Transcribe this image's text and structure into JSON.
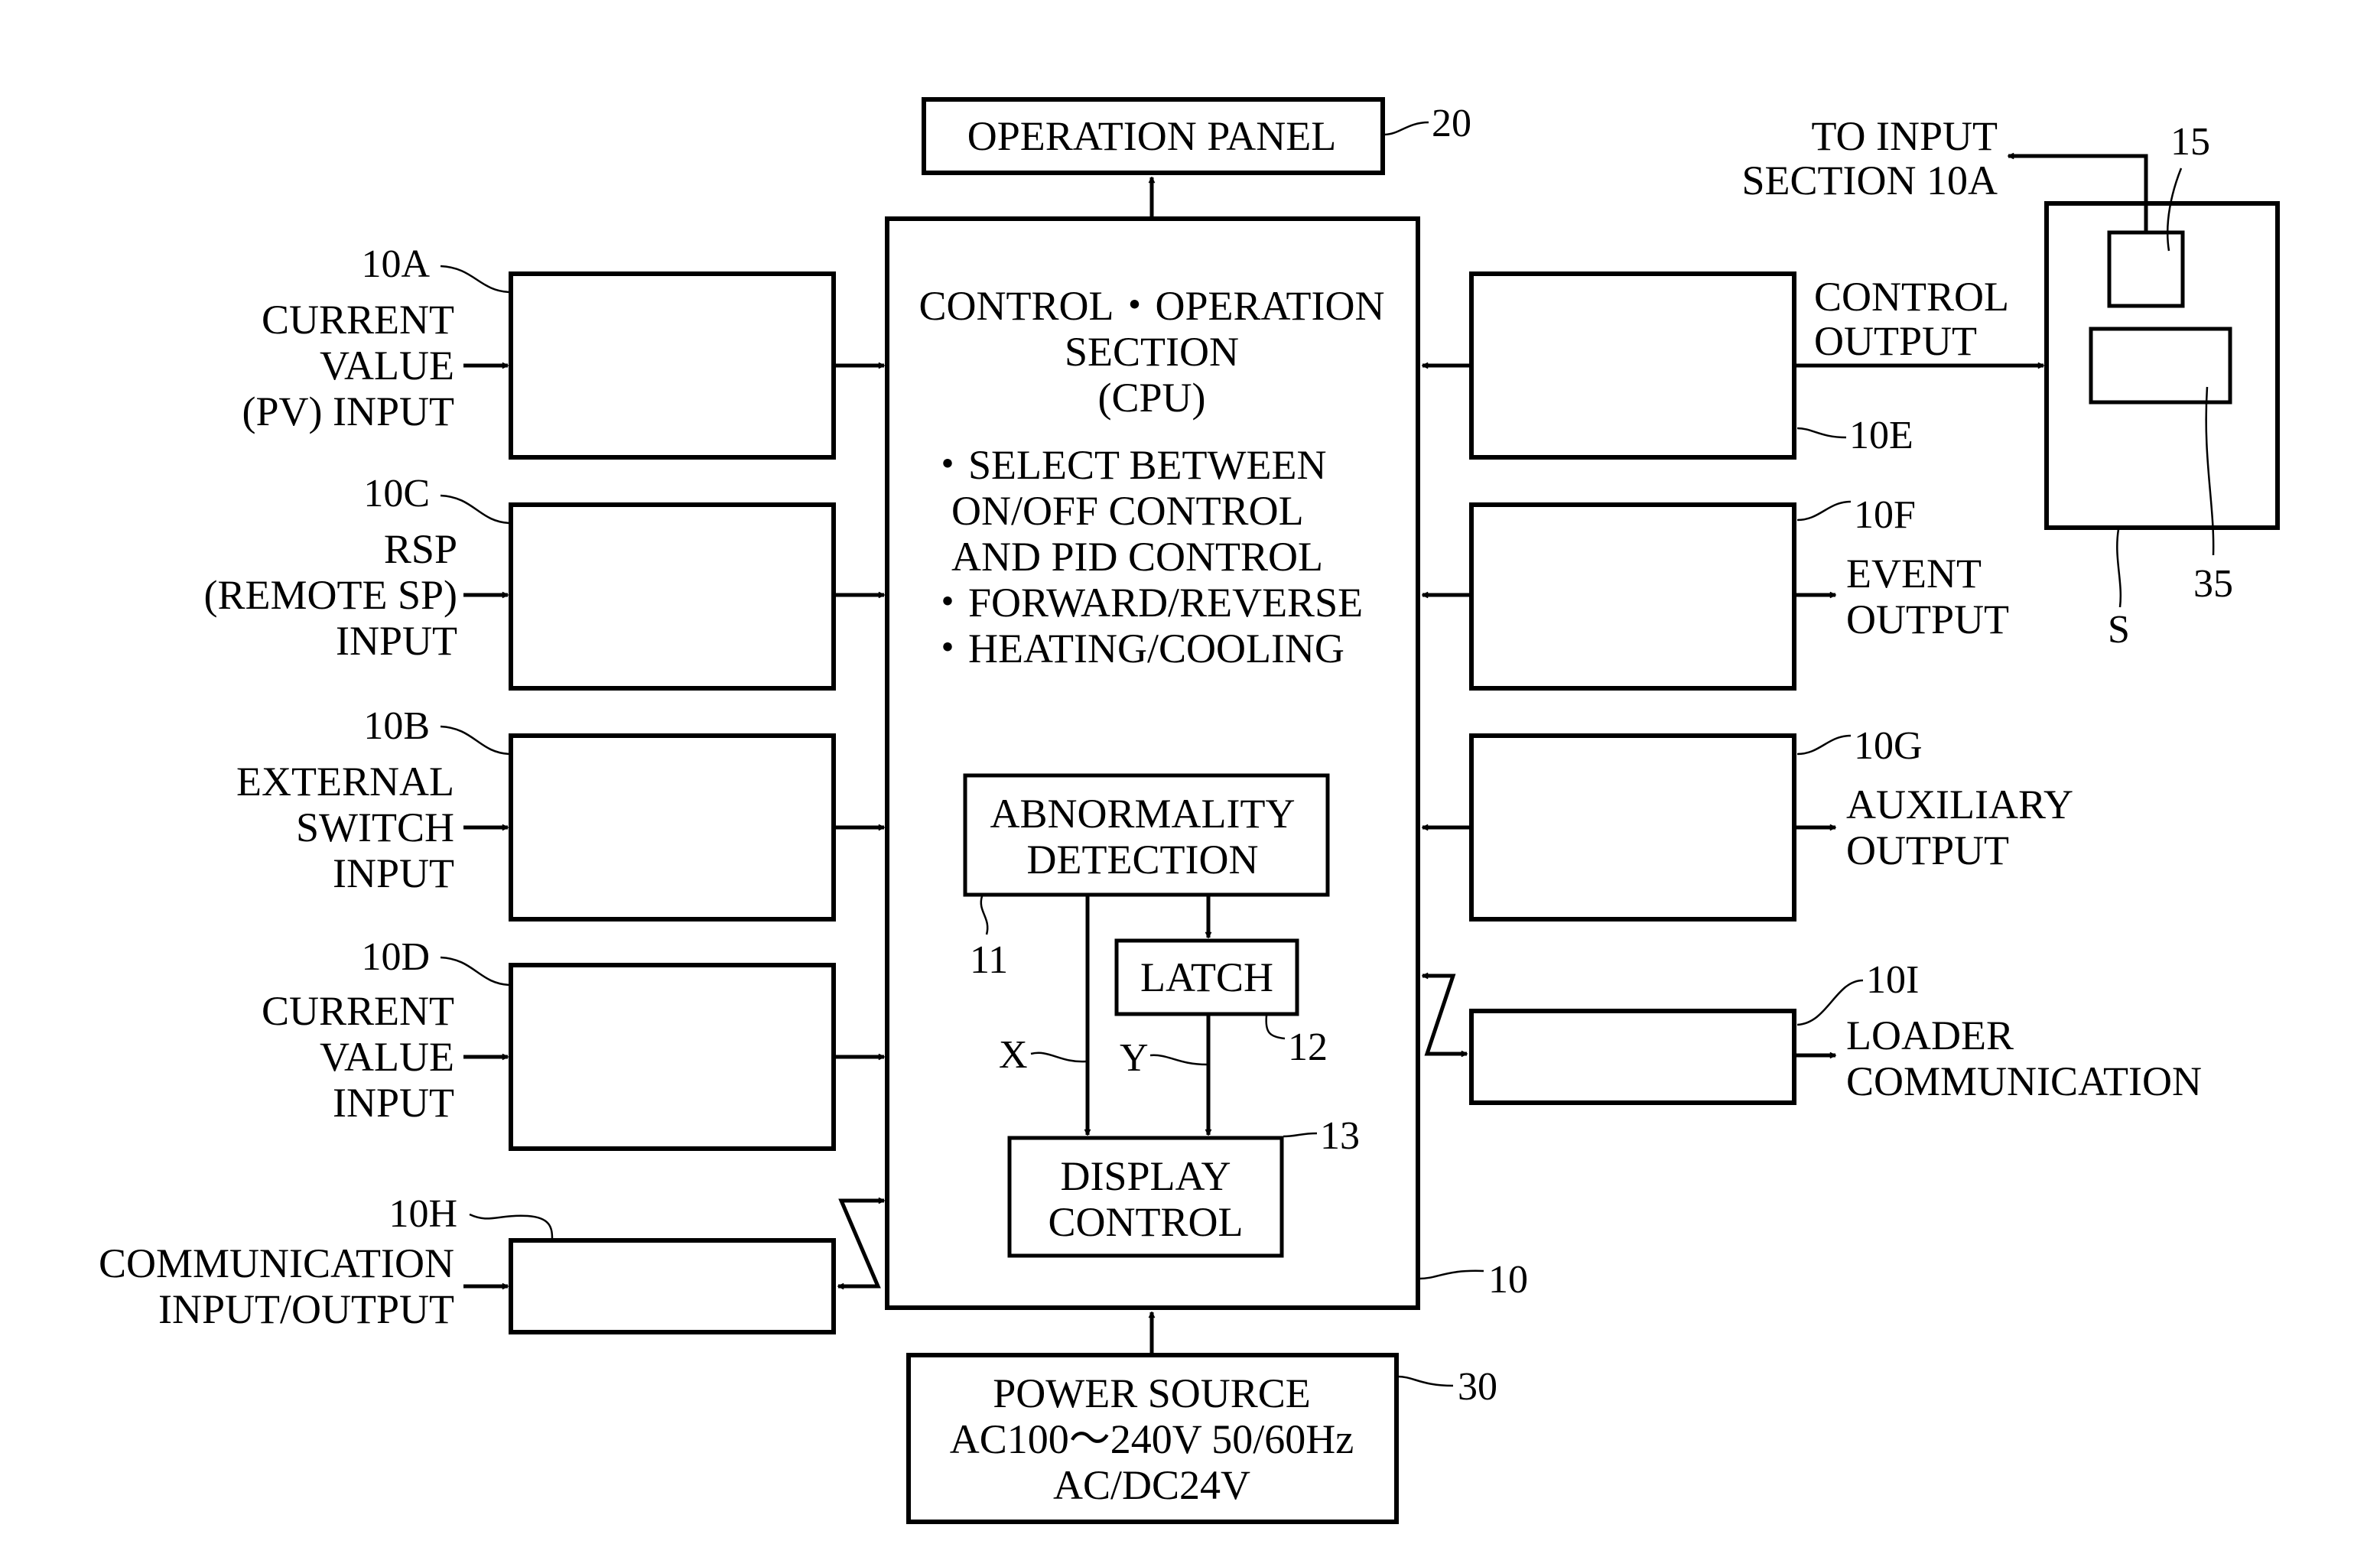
{
  "diagram": {
    "operation_panel": {
      "label": "OPERATION PANEL",
      "ref": "20"
    },
    "cpu": {
      "title_lines": [
        "CONTROL・OPERATION",
        "SECTION",
        "(CPU)"
      ],
      "features": [
        "・SELECT BETWEEN",
        "ON/OFF CONTROL",
        "AND PID CONTROL",
        "・FORWARD/REVERSE",
        "・HEATING/COOLING"
      ],
      "ref": "10"
    },
    "abnormality_detection": {
      "lines": [
        "ABNORMALITY",
        "DETECTION"
      ],
      "ref": "11"
    },
    "latch": {
      "label": "LATCH",
      "ref": "12"
    },
    "display_control": {
      "lines": [
        "DISPLAY",
        "CONTROL"
      ],
      "ref": "13"
    },
    "signal_x": "X",
    "signal_y": "Y",
    "power_source": {
      "lines": [
        "POWER SOURCE",
        "AC100～240V 50/60Hz",
        "AC/DC24V"
      ],
      "ref": "30"
    },
    "inputs": [
      {
        "ref": "10A",
        "lines": [
          "CURRENT",
          "VALUE",
          "(PV) INPUT"
        ]
      },
      {
        "ref": "10C",
        "lines": [
          "RSP",
          "(REMOTE SP)",
          "INPUT"
        ]
      },
      {
        "ref": "10B",
        "lines": [
          "EXTERNAL",
          "SWITCH",
          "INPUT"
        ]
      },
      {
        "ref": "10D",
        "lines": [
          "CURRENT",
          "VALUE",
          "INPUT"
        ]
      },
      {
        "ref": "10H",
        "lines": [
          "COMMUNICATION",
          "INPUT/OUTPUT"
        ]
      }
    ],
    "outputs": [
      {
        "ref": "10E",
        "lines": [
          "CONTROL",
          "OUTPUT"
        ]
      },
      {
        "ref": "10F",
        "lines": [
          "EVENT",
          "OUTPUT"
        ]
      },
      {
        "ref": "10G",
        "lines": [
          "AUXILIARY",
          "OUTPUT"
        ]
      },
      {
        "ref": "10I",
        "lines": [
          "LOADER",
          "COMMUNICATION"
        ]
      }
    ],
    "sensor": {
      "ref": "S",
      "feedback_lines": [
        "TO INPUT",
        "SECTION 10A"
      ],
      "element_upper_ref": "15",
      "element_lower_ref": "35"
    }
  }
}
